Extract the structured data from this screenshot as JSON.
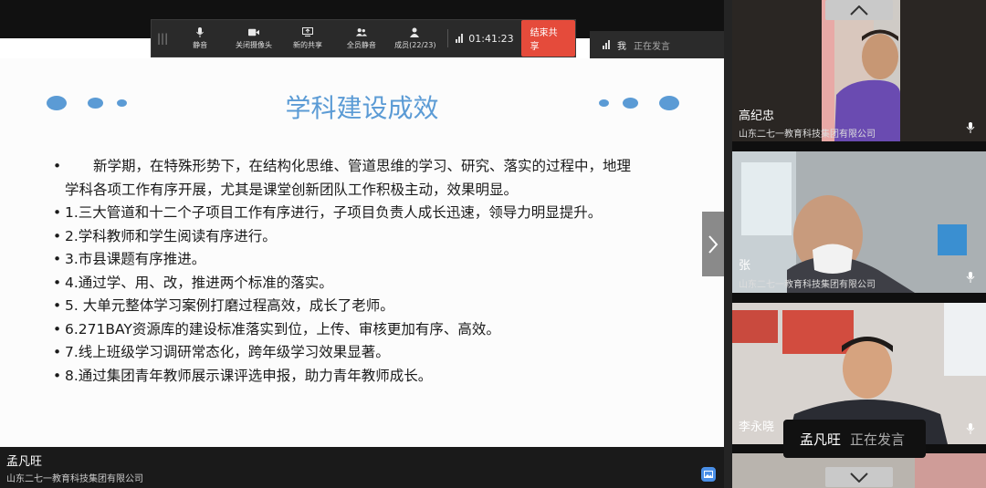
{
  "toolbar": {
    "items": [
      {
        "label": "静音",
        "icon": "microphone-icon"
      },
      {
        "label": "关闭摄像头",
        "icon": "camera-icon"
      },
      {
        "label": "新的共享",
        "icon": "share-screen-icon"
      },
      {
        "label": "全员静音",
        "icon": "mute-all-icon"
      },
      {
        "label": "成员(22/23)",
        "icon": "members-icon"
      }
    ],
    "timer": "01:41:23",
    "stop_label": "结束共享"
  },
  "top_speaking": {
    "name": "我",
    "status": "正在发言"
  },
  "slide": {
    "title": "学科建设成效",
    "bullet_mark": "•",
    "lines": [
      {
        "bullet": true,
        "text": "　　新学期，在特殊形势下，在结构化思维、管道思维的学习、研究、落实的过程中，地理"
      },
      {
        "bullet": false,
        "text": "学科各项工作有序开展，尤其是课堂创新团队工作积极主动，效果明显。"
      },
      {
        "bullet": true,
        "text": "1.三大管道和十二个子项目工作有序进行，子项目负责人成长迅速，领导力明显提升。"
      },
      {
        "bullet": true,
        "text": "2.学科教师和学生阅读有序进行。"
      },
      {
        "bullet": true,
        "text": "3.市县课题有序推进。"
      },
      {
        "bullet": true,
        "text": "4.通过学、用、改，推进两个标准的落实。"
      },
      {
        "bullet": true,
        "text": "5. 大单元整体学习案例打磨过程高效，成长了老师。"
      },
      {
        "bullet": true,
        "text": "6.271BAY资源库的建设标准落实到位，上传、审核更加有序、高效。"
      },
      {
        "bullet": true,
        "text": "7.线上班级学习调研常态化，跨年级学习效果显著。"
      },
      {
        "bullet": true,
        "text": "8.通过集团青年教师展示课评选申报，助力青年教师成长。"
      }
    ]
  },
  "presenter": {
    "name": "孟凡旺",
    "org": "山东二七一教育科技集团有限公司"
  },
  "participants": [
    {
      "name": "高纪忠",
      "org": "山东二七一教育科技集团有限公司"
    },
    {
      "name": "张",
      "org": "山东二七一教育科技集团有限公司"
    },
    {
      "name": "李永晓",
      "org": ""
    }
  ],
  "speaking_popup": {
    "name": "孟凡旺",
    "status": "正在发言"
  },
  "colors": {
    "accent": "#5b9bd5",
    "stop": "#e54b3b"
  }
}
